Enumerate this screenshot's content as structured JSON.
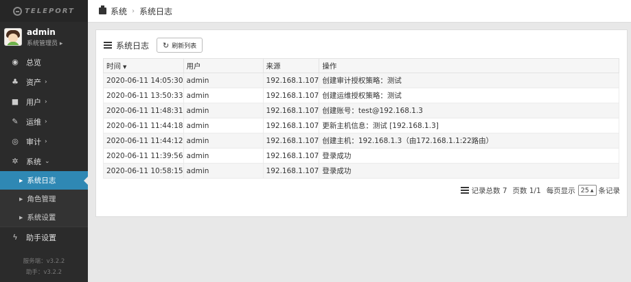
{
  "brand": {
    "logo_text": "TELEPORT"
  },
  "user": {
    "name": "admin",
    "role": "系统管理员 ▸"
  },
  "nav": {
    "items": [
      {
        "label": "总览",
        "icon": "dashboard-icon",
        "glyph": "◉"
      },
      {
        "label": "资产",
        "icon": "cubes-icon",
        "glyph": "♣",
        "chevron": "›"
      },
      {
        "label": "用户",
        "icon": "address-card-icon",
        "glyph": "■",
        "chevron": "›"
      },
      {
        "label": "运维",
        "icon": "wrench-icon",
        "glyph": "✎",
        "chevron": "›"
      },
      {
        "label": "审计",
        "icon": "eye-icon",
        "glyph": "◎",
        "chevron": "›"
      },
      {
        "label": "系统",
        "icon": "gear-icon",
        "glyph": "✲",
        "chevron": "⌄"
      }
    ],
    "sub_items": [
      {
        "label": "系统日志",
        "active": true
      },
      {
        "label": "角色管理"
      },
      {
        "label": "系统设置"
      }
    ],
    "assistant": {
      "label": "助手设置",
      "icon": "bolt-icon",
      "glyph": "ϟ"
    }
  },
  "footer": {
    "server_version": "服务端：v3.2.2",
    "assistant_version": "助手：v3.2.2"
  },
  "breadcrumb": {
    "root": "系统",
    "separator": "›",
    "current": "系统日志"
  },
  "panel": {
    "title": "系统日志",
    "refresh_label": "刷新列表"
  },
  "table": {
    "headers": [
      "时间",
      "用户",
      "来源",
      "操作"
    ],
    "rows": [
      [
        "2020-06-11 14:05:30",
        "admin",
        "192.168.1.107",
        "创建审计授权策略：测试"
      ],
      [
        "2020-06-11 13:50:33",
        "admin",
        "192.168.1.107",
        "创建运维授权策略：测试"
      ],
      [
        "2020-06-11 11:48:31",
        "admin",
        "192.168.1.107",
        "创建账号：test@192.168.1.3"
      ],
      [
        "2020-06-11 11:44:18",
        "admin",
        "192.168.1.107",
        "更新主机信息：测试 [192.168.1.3]"
      ],
      [
        "2020-06-11 11:44:12",
        "admin",
        "192.168.1.107",
        "创建主机：192.168.1.3（由172.168.1.1:22路由）"
      ],
      [
        "2020-06-11 11:39:56",
        "admin",
        "192.168.1.107",
        "登录成功"
      ],
      [
        "2020-06-11 10:58:15",
        "admin",
        "192.168.1.107",
        "登录成功"
      ]
    ]
  },
  "pager": {
    "total_label": "记录总数 7",
    "page_label": "页数 1/1",
    "per_page_label": "每页显示",
    "page_size": "25",
    "suffix": "条记录"
  }
}
